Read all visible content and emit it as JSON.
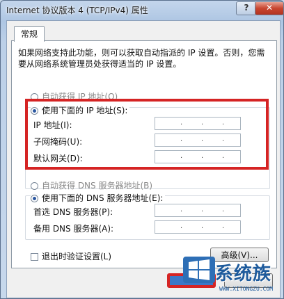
{
  "window": {
    "title": "Internet 协议版本 4 (TCP/IPv4) 属性",
    "help_label": "?",
    "close_label": "✕"
  },
  "tab": {
    "label": "常规"
  },
  "description": "如果网络支持此功能，则可以获取自动指派的 IP 设置。否则，您需要从网络系统管理员处获得适当的 IP 设置。",
  "ip": {
    "auto_label": "自动获得 IP 地址(O)",
    "manual_label": "使用下面的 IP 地址(S):",
    "selected": "manual",
    "fields": [
      {
        "label": "IP 地址(I):",
        "value": ""
      },
      {
        "label": "子网掩码(U):",
        "value": ""
      },
      {
        "label": "默认网关(D):",
        "value": ""
      }
    ]
  },
  "dns": {
    "auto_label": "自动获得 DNS 服务器地址(B)",
    "manual_label": "使用下面的 DNS 服务器地址(E):",
    "selected": "manual",
    "fields": [
      {
        "label": "首选 DNS 服务器(P):",
        "value": ""
      },
      {
        "label": "备用 DNS 服务器(A):",
        "value": ""
      }
    ]
  },
  "validate_label": "退出时验证设置(L)",
  "validate_checked": false,
  "advanced_label": "高级(V)...",
  "watermark": {
    "text": "系统族",
    "url": "WWW.XITONGZU.COM"
  },
  "colors": {
    "highlight": "#d52424",
    "radio_dot": "#2b57a0"
  }
}
